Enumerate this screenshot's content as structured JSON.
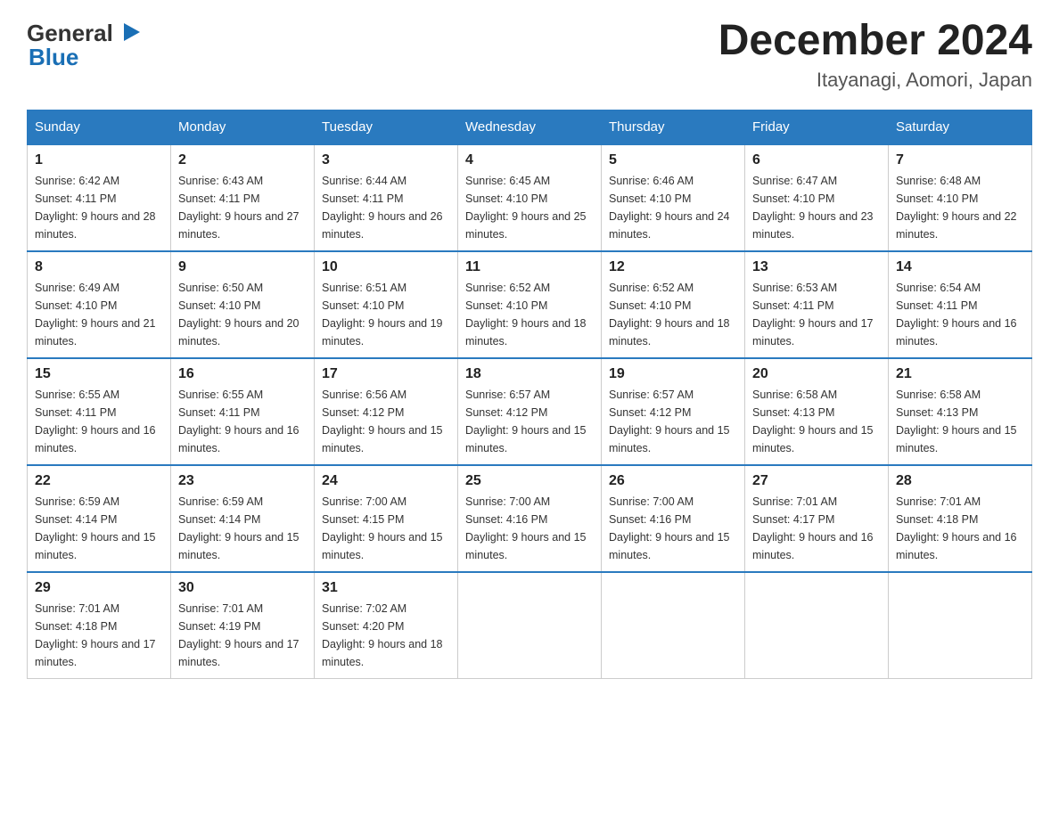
{
  "logo": {
    "text_general": "General",
    "text_blue": "Blue",
    "arrow_color": "#1a6fb5"
  },
  "title": "December 2024",
  "location": "Itayanagi, Aomori, Japan",
  "days_of_week": [
    "Sunday",
    "Monday",
    "Tuesday",
    "Wednesday",
    "Thursday",
    "Friday",
    "Saturday"
  ],
  "weeks": [
    [
      {
        "day": "1",
        "sunrise": "6:42 AM",
        "sunset": "4:11 PM",
        "daylight": "9 hours and 28 minutes."
      },
      {
        "day": "2",
        "sunrise": "6:43 AM",
        "sunset": "4:11 PM",
        "daylight": "9 hours and 27 minutes."
      },
      {
        "day": "3",
        "sunrise": "6:44 AM",
        "sunset": "4:11 PM",
        "daylight": "9 hours and 26 minutes."
      },
      {
        "day": "4",
        "sunrise": "6:45 AM",
        "sunset": "4:10 PM",
        "daylight": "9 hours and 25 minutes."
      },
      {
        "day": "5",
        "sunrise": "6:46 AM",
        "sunset": "4:10 PM",
        "daylight": "9 hours and 24 minutes."
      },
      {
        "day": "6",
        "sunrise": "6:47 AM",
        "sunset": "4:10 PM",
        "daylight": "9 hours and 23 minutes."
      },
      {
        "day": "7",
        "sunrise": "6:48 AM",
        "sunset": "4:10 PM",
        "daylight": "9 hours and 22 minutes."
      }
    ],
    [
      {
        "day": "8",
        "sunrise": "6:49 AM",
        "sunset": "4:10 PM",
        "daylight": "9 hours and 21 minutes."
      },
      {
        "day": "9",
        "sunrise": "6:50 AM",
        "sunset": "4:10 PM",
        "daylight": "9 hours and 20 minutes."
      },
      {
        "day": "10",
        "sunrise": "6:51 AM",
        "sunset": "4:10 PM",
        "daylight": "9 hours and 19 minutes."
      },
      {
        "day": "11",
        "sunrise": "6:52 AM",
        "sunset": "4:10 PM",
        "daylight": "9 hours and 18 minutes."
      },
      {
        "day": "12",
        "sunrise": "6:52 AM",
        "sunset": "4:10 PM",
        "daylight": "9 hours and 18 minutes."
      },
      {
        "day": "13",
        "sunrise": "6:53 AM",
        "sunset": "4:11 PM",
        "daylight": "9 hours and 17 minutes."
      },
      {
        "day": "14",
        "sunrise": "6:54 AM",
        "sunset": "4:11 PM",
        "daylight": "9 hours and 16 minutes."
      }
    ],
    [
      {
        "day": "15",
        "sunrise": "6:55 AM",
        "sunset": "4:11 PM",
        "daylight": "9 hours and 16 minutes."
      },
      {
        "day": "16",
        "sunrise": "6:55 AM",
        "sunset": "4:11 PM",
        "daylight": "9 hours and 16 minutes."
      },
      {
        "day": "17",
        "sunrise": "6:56 AM",
        "sunset": "4:12 PM",
        "daylight": "9 hours and 15 minutes."
      },
      {
        "day": "18",
        "sunrise": "6:57 AM",
        "sunset": "4:12 PM",
        "daylight": "9 hours and 15 minutes."
      },
      {
        "day": "19",
        "sunrise": "6:57 AM",
        "sunset": "4:12 PM",
        "daylight": "9 hours and 15 minutes."
      },
      {
        "day": "20",
        "sunrise": "6:58 AM",
        "sunset": "4:13 PM",
        "daylight": "9 hours and 15 minutes."
      },
      {
        "day": "21",
        "sunrise": "6:58 AM",
        "sunset": "4:13 PM",
        "daylight": "9 hours and 15 minutes."
      }
    ],
    [
      {
        "day": "22",
        "sunrise": "6:59 AM",
        "sunset": "4:14 PM",
        "daylight": "9 hours and 15 minutes."
      },
      {
        "day": "23",
        "sunrise": "6:59 AM",
        "sunset": "4:14 PM",
        "daylight": "9 hours and 15 minutes."
      },
      {
        "day": "24",
        "sunrise": "7:00 AM",
        "sunset": "4:15 PM",
        "daylight": "9 hours and 15 minutes."
      },
      {
        "day": "25",
        "sunrise": "7:00 AM",
        "sunset": "4:16 PM",
        "daylight": "9 hours and 15 minutes."
      },
      {
        "day": "26",
        "sunrise": "7:00 AM",
        "sunset": "4:16 PM",
        "daylight": "9 hours and 15 minutes."
      },
      {
        "day": "27",
        "sunrise": "7:01 AM",
        "sunset": "4:17 PM",
        "daylight": "9 hours and 16 minutes."
      },
      {
        "day": "28",
        "sunrise": "7:01 AM",
        "sunset": "4:18 PM",
        "daylight": "9 hours and 16 minutes."
      }
    ],
    [
      {
        "day": "29",
        "sunrise": "7:01 AM",
        "sunset": "4:18 PM",
        "daylight": "9 hours and 17 minutes."
      },
      {
        "day": "30",
        "sunrise": "7:01 AM",
        "sunset": "4:19 PM",
        "daylight": "9 hours and 17 minutes."
      },
      {
        "day": "31",
        "sunrise": "7:02 AM",
        "sunset": "4:20 PM",
        "daylight": "9 hours and 18 minutes."
      },
      null,
      null,
      null,
      null
    ]
  ]
}
